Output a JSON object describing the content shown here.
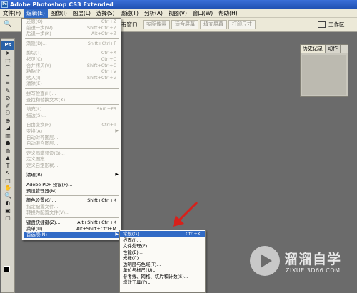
{
  "app": {
    "title": "Adobe Photoshop CS3 Extended",
    "logo": "Ps"
  },
  "menubar": {
    "items": [
      "文件(F)",
      "编辑(E)",
      "图像(I)",
      "图层(L)",
      "选择(S)",
      "滤镜(T)",
      "分析(A)",
      "视图(V)",
      "窗口(W)",
      "帮助(H)"
    ],
    "active_index": 1
  },
  "optionsbar": {
    "label_all_windows": "有窗口",
    "buttons": [
      "实际像素",
      "适合屏幕",
      "填充屏幕",
      "打印尺寸"
    ],
    "workspace": "工作区"
  },
  "history_panel": {
    "tabs": [
      "历史记录",
      "动作"
    ]
  },
  "edit_menu": [
    {
      "label": "还原(O)",
      "shortcut": "Ctrl+Z",
      "disabled": true
    },
    {
      "label": "前进一步(W)",
      "shortcut": "Shift+Ctrl+Z",
      "disabled": true
    },
    {
      "label": "后退一步(K)",
      "shortcut": "Alt+Ctrl+Z",
      "disabled": true
    },
    {
      "sep": true
    },
    {
      "label": "渐隐(D)...",
      "shortcut": "Shift+Ctrl+F",
      "disabled": true
    },
    {
      "sep": true
    },
    {
      "label": "剪切(T)",
      "shortcut": "Ctrl+X",
      "disabled": true
    },
    {
      "label": "拷贝(C)",
      "shortcut": "Ctrl+C",
      "disabled": true
    },
    {
      "label": "合并拷贝(Y)",
      "shortcut": "Shift+Ctrl+C",
      "disabled": true
    },
    {
      "label": "粘贴(P)",
      "shortcut": "Ctrl+V",
      "disabled": true
    },
    {
      "label": "贴入(I)",
      "shortcut": "Shift+Ctrl+V",
      "disabled": true
    },
    {
      "label": "清除(E)",
      "shortcut": "",
      "disabled": true
    },
    {
      "sep": true
    },
    {
      "label": "拼写检查(H)...",
      "shortcut": "",
      "disabled": true
    },
    {
      "label": "查找和替换文本(X)...",
      "shortcut": "",
      "disabled": true
    },
    {
      "sep": true
    },
    {
      "label": "填充(L)...",
      "shortcut": "Shift+F5",
      "disabled": true
    },
    {
      "label": "描边(S)...",
      "shortcut": "",
      "disabled": true
    },
    {
      "sep": true
    },
    {
      "label": "自由变换(F)",
      "shortcut": "Ctrl+T",
      "disabled": true
    },
    {
      "label": "变换(A)",
      "shortcut": "",
      "disabled": true,
      "arrow": true
    },
    {
      "label": "自动对齐图层...",
      "shortcut": "",
      "disabled": true
    },
    {
      "label": "自动混合图层...",
      "shortcut": "",
      "disabled": true
    },
    {
      "sep": true
    },
    {
      "label": "定义画笔预设(B)...",
      "shortcut": "",
      "disabled": true
    },
    {
      "label": "定义图案...",
      "shortcut": "",
      "disabled": true
    },
    {
      "label": "定义自定形状...",
      "shortcut": "",
      "disabled": true
    },
    {
      "sep": true
    },
    {
      "label": "清理(R)",
      "shortcut": "",
      "disabled": false,
      "arrow": true
    },
    {
      "sep": true
    },
    {
      "label": "Adobe PDF 预设(F)...",
      "shortcut": "",
      "disabled": false
    },
    {
      "label": "预设管理器(M)...",
      "shortcut": "",
      "disabled": false
    },
    {
      "sep": true
    },
    {
      "label": "颜色设置(G)...",
      "shortcut": "Shift+Ctrl+K",
      "disabled": false
    },
    {
      "label": "指定配置文件...",
      "shortcut": "",
      "disabled": true
    },
    {
      "label": "转换为配置文件(V)...",
      "shortcut": "",
      "disabled": true
    },
    {
      "sep": true
    },
    {
      "label": "键盘快捷键(Z)...",
      "shortcut": "Alt+Shift+Ctrl+K",
      "disabled": false
    },
    {
      "label": "菜单(U)...",
      "shortcut": "Alt+Shift+Ctrl+M",
      "disabled": false
    },
    {
      "label": "首选项(N)",
      "shortcut": "",
      "disabled": false,
      "arrow": true,
      "highlighted": true
    }
  ],
  "prefs_submenu": [
    {
      "label": "常规(G)...",
      "shortcut": "Ctrl+K",
      "highlighted": true
    },
    {
      "label": "界面(I)...",
      "shortcut": ""
    },
    {
      "label": "文件处理(F)...",
      "shortcut": ""
    },
    {
      "label": "性能(E)...",
      "shortcut": ""
    },
    {
      "label": "光标(C)...",
      "shortcut": ""
    },
    {
      "label": "透明度与色域(T)...",
      "shortcut": ""
    },
    {
      "label": "单位与标尺(U)...",
      "shortcut": ""
    },
    {
      "label": "参考线、网格、切片和计数(S)...",
      "shortcut": ""
    },
    {
      "label": "增效工具(P)...",
      "shortcut": ""
    }
  ],
  "watermark": {
    "title": "溜溜自学",
    "url": "ZIXUE.3D66.COM"
  },
  "colors": {
    "accent": "#316ac5",
    "arrow": "#d8201a",
    "workspace_bg": "#6b6b6b"
  }
}
